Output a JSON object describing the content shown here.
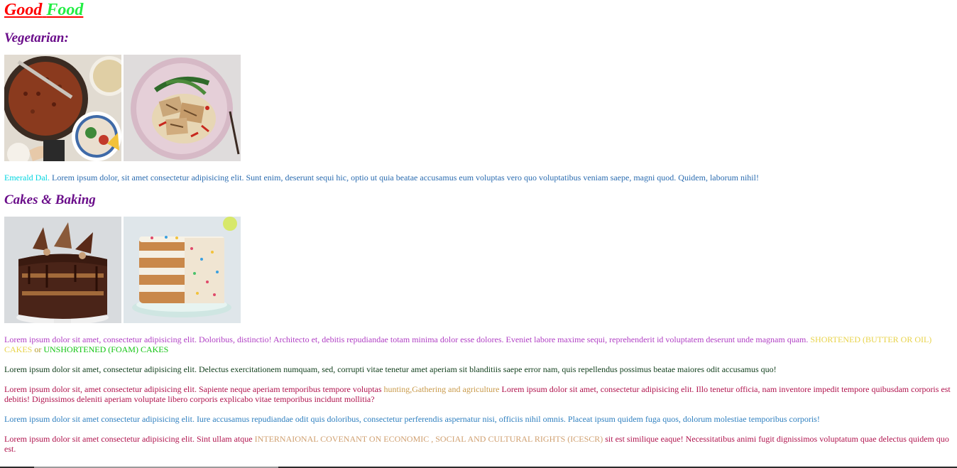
{
  "site_title": {
    "word1": "Good",
    "word2": "Food"
  },
  "sections": {
    "vegetarian": {
      "heading": "Vegetarian:"
    },
    "cakes": {
      "heading": "Cakes & Baking"
    }
  },
  "paragraphs": {
    "dal": {
      "highlight": "Emerald Dal.",
      "text": " Lorem ipsum dolor, sit amet consectetur adipisicing elit. Sunt enim, deserunt sequi hic, optio ut quia beatae accusamus eum voluptas vero quo voluptatibus veniam saepe, magni quod. Quidem, laborum nihil!"
    },
    "cakes": {
      "text": "Lorem ipsum dolor sit amet, consectetur adipisicing elit. Doloribus, distinctio! Architecto et, debitis repudiandae totam minima dolor esse dolores. Eveniet labore maxime sequi, reprehenderit id voluptatem deserunt unde magnam quam. ",
      "shortened": "SHORTENED (BUTTER OR OIL) CAKES",
      "or": " or ",
      "unshortened": "UNSHORTENED (FOAM) CAKES"
    },
    "lorem2": "Lorem ipsum dolor sit amet, consectetur adipisicing elit. Delectus exercitationem numquam, sed, corrupti vitae tenetur amet aperiam sit blanditiis saepe error nam, quis repellendus possimus beatae maiores odit accusamus quo!",
    "lorem3": {
      "text1": "Lorem ipsum dolor sit, amet consectetur adipisicing elit. Sapiente neque aperiam temporibus tempore voluptas ",
      "highlight": "hunting,Gathering and agriculture",
      "text2": " Lorem ipsum dolor sit amet, consectetur adipisicing elit. Illo tenetur officia, nam inventore impedit tempore quibusdam corporis est debitis! Dignissimos deleniti aperiam voluptate libero corporis explicabo vitae temporibus incidunt mollitia?"
    },
    "lorem4": "Lorem ipsum dolor sit amet consectetur adipisicing elit. Iure accusamus repudiandae odit quis doloribus, consectetur perferendis aspernatur nisi, officiis nihil omnis. Placeat ipsum quidem fuga quos, dolorum molestiae temporibus corporis!",
    "lorem5": {
      "text1": "Lorem ipsum dolor sit amet consectetur adipisicing elit. Sint ullam atque ",
      "highlight": "INTERNAIONAL COVENANT ON ECONOMIC , SOCIAL AND CULTURAL RIGHTS (ICESCR)",
      "text2": " sit est similique eaque! Necessitatibus animi fugit dignissimos voluptatum quae delectus quidem quo est."
    }
  },
  "colors": {
    "title_red": "#ff0000",
    "title_green": "#22ee44",
    "heading_purple": "#6a0d8a"
  },
  "scroll": {
    "horizontal_position": 0.04
  }
}
